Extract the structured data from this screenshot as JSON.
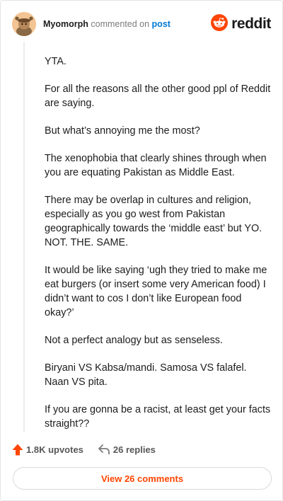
{
  "header": {
    "username": "Myomorph",
    "action_text": "commented on",
    "post_link": "post",
    "brand_name": "reddit"
  },
  "comment": {
    "paragraphs": [
      "YTA.",
      "For all the reasons all the other good ppl of Reddit are saying.",
      "But what’s annoying me the most?",
      "The xenophobia that clearly shines through when you are equating Pakistan as Middle East.",
      "There may be overlap in cultures and religion, especially as you go west from Pakistan geographically towards the ‘middle east’ but YO. NOT. THE. SAME.",
      "It would be like saying ‘ugh they tried to make me eat burgers (or insert some very American food) I didn’t want to cos I don’t like European food okay?’",
      "Not a perfect analogy but as senseless.",
      "Biryani VS Kabsa/mandi. Samosa VS falafel. Naan VS pita.",
      "If you are gonna be a racist, at least get your facts straight??"
    ]
  },
  "footer": {
    "upvotes": "1.8K upvotes",
    "replies": "26 replies",
    "view_button": "View 26 comments"
  },
  "colors": {
    "brand_orange": "#ff4500",
    "link_blue": "#0079d3",
    "muted_gray": "#7c7c7c"
  },
  "icons": {
    "avatar": "user-avatar",
    "brand": "reddit-snoo-icon",
    "upvote": "upvote-arrow-icon",
    "reply": "reply-arrow-icon"
  }
}
